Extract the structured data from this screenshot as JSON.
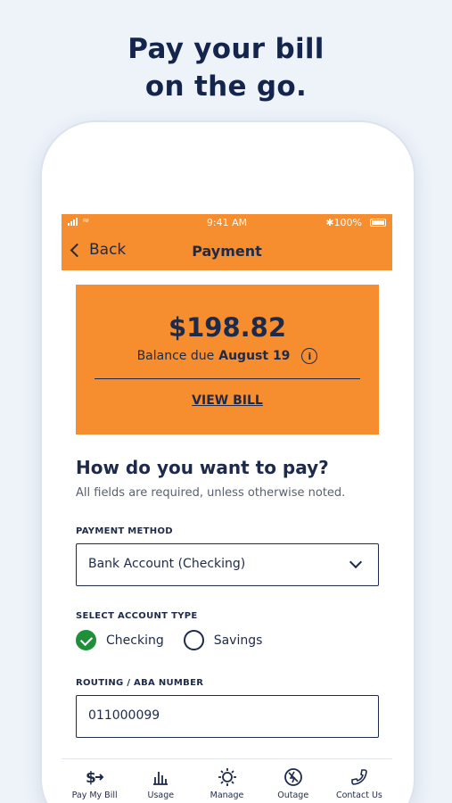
{
  "headline": {
    "line1": "Pay your bill",
    "line2": "on the go."
  },
  "statusbar": {
    "time": "9:41 AM",
    "battery": "100%"
  },
  "navbar": {
    "back_label": "Back",
    "title": "Payment"
  },
  "balance": {
    "amount": "$198.82",
    "due_prefix": "Balance due",
    "due_date": "August 19",
    "view_bill_label": "VIEW BILL"
  },
  "form": {
    "title": "How do you want to pay?",
    "subtitle": "All fields are required, unless otherwise noted.",
    "payment_method_label": "PAYMENT METHOD",
    "payment_method_value": "Bank Account (Checking)",
    "account_type_label": "SELECT ACCOUNT TYPE",
    "account_types": [
      {
        "label": "Checking",
        "selected": true
      },
      {
        "label": "Savings",
        "selected": false
      }
    ],
    "routing_label": "ROUTING / ABA NUMBER",
    "routing_value": "011000099"
  },
  "tabs": [
    {
      "label": "Pay My Bill",
      "icon": "pay-bill-icon",
      "active": true
    },
    {
      "label": "Usage",
      "icon": "usage-icon",
      "active": false
    },
    {
      "label": "Manage",
      "icon": "manage-icon",
      "active": false
    },
    {
      "label": "Outage",
      "icon": "outage-icon",
      "active": false
    },
    {
      "label": "Contact Us",
      "icon": "phone-icon",
      "active": false
    }
  ],
  "colors": {
    "accent": "#f68d2e",
    "navy": "#1d2a4a",
    "success": "#1f8f3a",
    "background": "#eef3fa"
  }
}
